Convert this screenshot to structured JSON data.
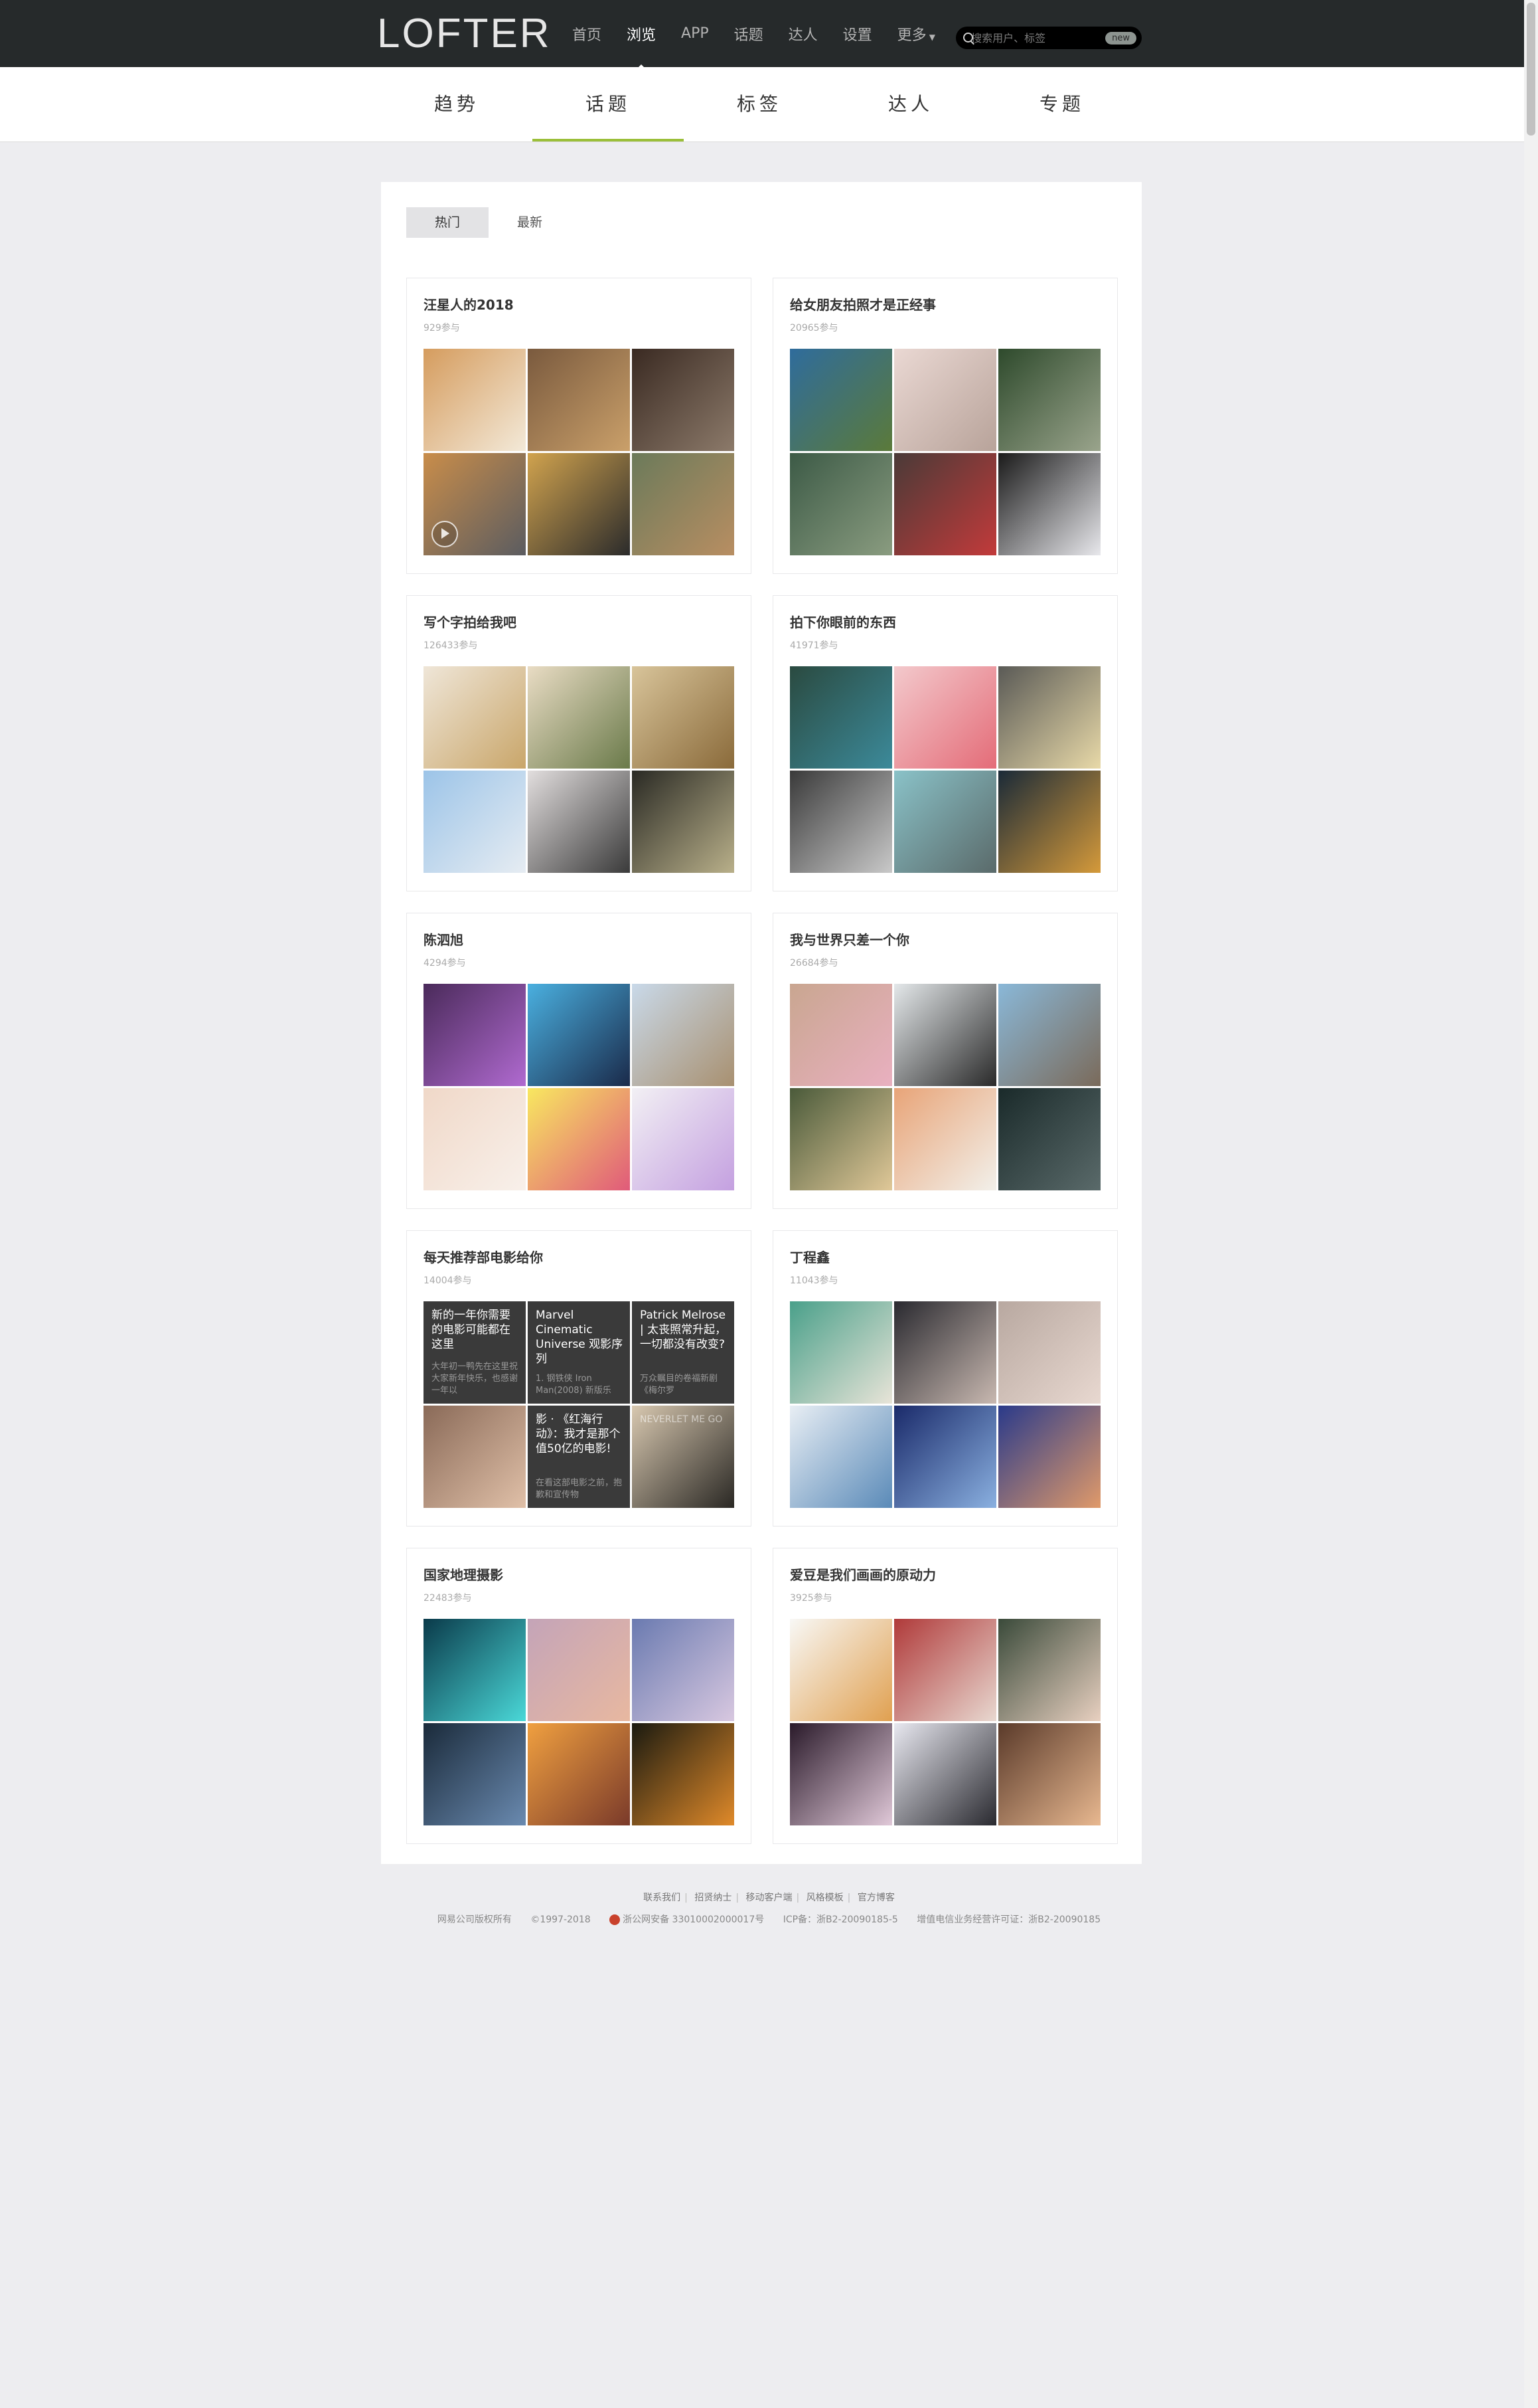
{
  "header": {
    "logo": "LOFTER",
    "nav": [
      {
        "label": "首页",
        "active": false
      },
      {
        "label": "浏览",
        "active": true
      },
      {
        "label": "APP",
        "active": false
      },
      {
        "label": "话题",
        "active": false
      },
      {
        "label": "达人",
        "active": false
      },
      {
        "label": "设置",
        "active": false
      },
      {
        "label": "更多",
        "active": false
      }
    ],
    "search_placeholder": "搜索用户、标签",
    "search_badge": "new"
  },
  "subnav": [
    "趋势",
    "话题",
    "标签",
    "达人",
    "专题"
  ],
  "subnav_active": 1,
  "filters": [
    {
      "label": "热门",
      "active": true
    },
    {
      "label": "最新",
      "active": false
    }
  ],
  "topics": [
    {
      "title": "汪星人的2018",
      "count": "929参与",
      "cells": [
        {
          "c1": "#d59c5e",
          "c2": "#f3e9d8"
        },
        {
          "c1": "#7a5a3e",
          "c2": "#caa06a"
        },
        {
          "c1": "#3a2a22",
          "c2": "#8c7a6a"
        },
        {
          "c1": "#c98d4a",
          "c2": "#5b5c60",
          "play": true
        },
        {
          "c1": "#d1a34e",
          "c2": "#2b2b2b"
        },
        {
          "c1": "#6b7a5a",
          "c2": "#b88e62"
        }
      ]
    },
    {
      "title": "给女朋友拍照才是正经事",
      "count": "20965参与",
      "cells": [
        {
          "c1": "#2f6c9c",
          "c2": "#5b7a3a"
        },
        {
          "c1": "#ead8d3",
          "c2": "#b8a39a"
        },
        {
          "c1": "#2e4a2c",
          "c2": "#9aa48c"
        },
        {
          "c1": "#3c5a46",
          "c2": "#8a9c80"
        },
        {
          "c1": "#4a3a38",
          "c2": "#c23a3a"
        },
        {
          "c1": "#1a1a1a",
          "c2": "#e8e8ec"
        }
      ]
    },
    {
      "title": "写个字拍给我吧",
      "count": "126433参与",
      "cells": [
        {
          "c1": "#efe6d8",
          "c2": "#c9a66a"
        },
        {
          "c1": "#e9dcc4",
          "c2": "#6a7a4a"
        },
        {
          "c1": "#d8c49a",
          "c2": "#8a6a3a"
        },
        {
          "c1": "#9cc4e8",
          "c2": "#e6ecf2"
        },
        {
          "c1": "#e2dede",
          "c2": "#3a3a3a"
        },
        {
          "c1": "#2a2a24",
          "c2": "#b9b08a"
        }
      ]
    },
    {
      "title": "拍下你眼前的东西",
      "count": "41971参与",
      "cells": [
        {
          "c1": "#2a4a40",
          "c2": "#3c8a9a"
        },
        {
          "c1": "#f3c9cc",
          "c2": "#e46c78"
        },
        {
          "c1": "#5a5a56",
          "c2": "#e8d9a8"
        },
        {
          "c1": "#3a3a3a",
          "c2": "#c9c9c9"
        },
        {
          "c1": "#8ac2c8",
          "c2": "#5a6a6a"
        },
        {
          "c1": "#1a2a38",
          "c2": "#d59a3a"
        }
      ]
    },
    {
      "title": "陈泗旭",
      "count": "4294参与",
      "cells": [
        {
          "c1": "#4a2a5a",
          "c2": "#b06ad0"
        },
        {
          "c1": "#4ab0e0",
          "c2": "#1a2a4a"
        },
        {
          "c1": "#c9d9e9",
          "c2": "#a89070"
        },
        {
          "c1": "#f0d8c8",
          "c2": "#f8f0ea"
        },
        {
          "c1": "#f8e860",
          "c2": "#e05a7a"
        },
        {
          "c1": "#f2f0f4",
          "c2": "#c4a0e0"
        }
      ]
    },
    {
      "title": "我与世界只差一个你",
      "count": "26684参与",
      "cells": [
        {
          "c1": "#c9a690",
          "c2": "#e9b0c0"
        },
        {
          "c1": "#e4e8ea",
          "c2": "#2a2a2a"
        },
        {
          "c1": "#8ab8d8",
          "c2": "#7a6a5a"
        },
        {
          "c1": "#4a5a3a",
          "c2": "#e0c898"
        },
        {
          "c1": "#e8a478",
          "c2": "#f2f0ea"
        },
        {
          "c1": "#1a2a2a",
          "c2": "#5a6a6a"
        }
      ]
    },
    {
      "title": "每天推荐部电影给你",
      "count": "14004参与",
      "cells": [
        {
          "c1": "#3a3a3a",
          "c2": "#3a3a3a",
          "text": "新的一年你需要的电影可能都在这里",
          "sub": "大年初一鸭先在这里祝大家新年快乐，也感谢一年以"
        },
        {
          "c1": "#3a3a3a",
          "c2": "#3a3a3a",
          "text": "Marvel Cinematic Universe 观影序列",
          "sub": "1. 钢铁侠 Iron Man(2008) 新版乐"
        },
        {
          "c1": "#3a3a3a",
          "c2": "#3a3a3a",
          "text": "Patrick Melrose | 太丧照常升起，一切都没有改变?",
          "sub": "万众瞩目的卷福新剧《梅尔罗"
        },
        {
          "c1": "#8a6a58",
          "c2": "#e0c0a8"
        },
        {
          "c1": "#3a3a3a",
          "c2": "#3a3a3a",
          "text": "影 · 《红海行动》：我才是那个值50亿的电影!",
          "sub": "在看这部电影之前，抱歉和宣传物"
        },
        {
          "c1": "#d8c8b0",
          "c2": "#2a2824",
          "caption": "NEVERLET ME GO"
        }
      ]
    },
    {
      "title": "丁程鑫",
      "count": "11043参与",
      "cells": [
        {
          "c1": "#4aa08a",
          "c2": "#e8e4d8"
        },
        {
          "c1": "#2a2a30",
          "c2": "#c8b8b0"
        },
        {
          "c1": "#b8a8a0",
          "c2": "#e8d8d0"
        },
        {
          "c1": "#e8eef4",
          "c2": "#5a8ab8"
        },
        {
          "c1": "#1a2a6a",
          "c2": "#8ab0e0"
        },
        {
          "c1": "#2a3a8a",
          "c2": "#e09a6a"
        }
      ]
    },
    {
      "title": "国家地理摄影",
      "count": "22483参与",
      "cells": [
        {
          "c1": "#0a3a4a",
          "c2": "#4ad8d8"
        },
        {
          "c1": "#c4a4b8",
          "c2": "#e8b8a0"
        },
        {
          "c1": "#6a7ab0",
          "c2": "#d8c8e0"
        },
        {
          "c1": "#1a2a3a",
          "c2": "#6a8ab0"
        },
        {
          "c1": "#f0a040",
          "c2": "#7a3a2a"
        },
        {
          "c1": "#1a1a10",
          "c2": "#e08a2a"
        }
      ]
    },
    {
      "title": "爱豆是我们画画的原动力",
      "count": "3925参与",
      "cells": [
        {
          "c1": "#f8f8f6",
          "c2": "#e0a050"
        },
        {
          "c1": "#b03a3a",
          "c2": "#e8d8d0"
        },
        {
          "c1": "#3a4a3a",
          "c2": "#e8d0c0"
        },
        {
          "c1": "#2a1a2a",
          "c2": "#e0c8d8"
        },
        {
          "c1": "#e8e8f0",
          "c2": "#2a2a30"
        },
        {
          "c1": "#5a3a2a",
          "c2": "#e8b890"
        }
      ]
    }
  ],
  "footer": {
    "links": [
      "联系我们",
      "招贤纳士",
      "移动客户端",
      "风格模板",
      "官方博客"
    ],
    "copyright": "网易公司版权所有",
    "years": "©1997-2018",
    "police": "浙公网安备 33010002000017号",
    "icp": "ICP备：浙B2-20090185-5",
    "license": "增值电信业务经营许可证：浙B2-20090185"
  }
}
